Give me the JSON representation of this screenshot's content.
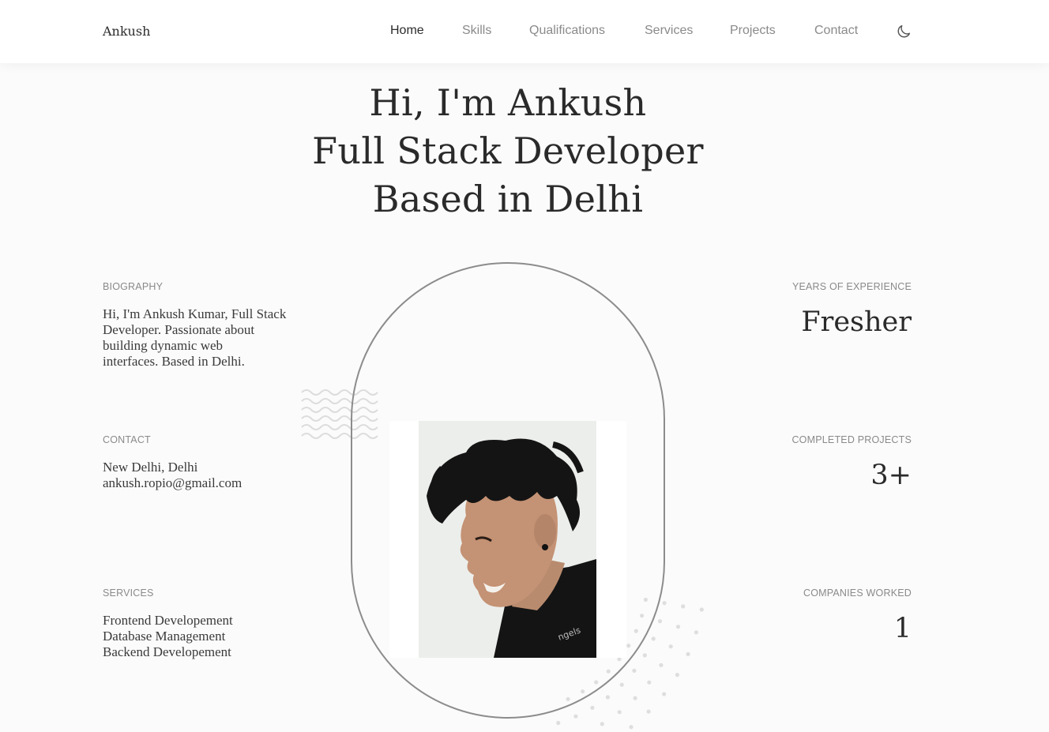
{
  "header": {
    "logo": "Ankush",
    "nav": [
      {
        "label": "Home",
        "active": true
      },
      {
        "label": "Skills",
        "active": false
      },
      {
        "label": "Qualifications",
        "active": false
      },
      {
        "label": "Services",
        "active": false
      },
      {
        "label": "Projects",
        "active": false
      },
      {
        "label": "Contact",
        "active": false
      }
    ],
    "theme_icon": "moon-icon"
  },
  "hero": {
    "lines": [
      "Hi, I'm Ankush",
      "Full Stack Developer",
      "Based in Delhi"
    ]
  },
  "biography": {
    "label": "BIOGRAPHY",
    "lines": [
      "Hi, I'm Ankush Kumar, Full Stack",
      "Developer. Passionate about",
      "building dynamic web",
      "interfaces. Based in Delhi."
    ]
  },
  "contact": {
    "label": "CONTACT",
    "lines": [
      "New Delhi, Delhi",
      "ankush.ropio@gmail.com"
    ]
  },
  "services": {
    "label": "SERVICES",
    "lines": [
      "Frontend Developement",
      "Database Management",
      "Backend Developement"
    ]
  },
  "stats": {
    "experience": {
      "label": "YEARS OF EXPERIENCE",
      "value": "Fresher"
    },
    "projects": {
      "label": "COMPLETED PROJECTS",
      "value": "3+"
    },
    "companies": {
      "label": "COMPANIES WORKED",
      "value": "1"
    }
  },
  "colors": {
    "background": "#fbfbfb",
    "text": "#2b2b2b",
    "muted": "#8a8a8a",
    "oval_border": "#8c8c8c"
  }
}
